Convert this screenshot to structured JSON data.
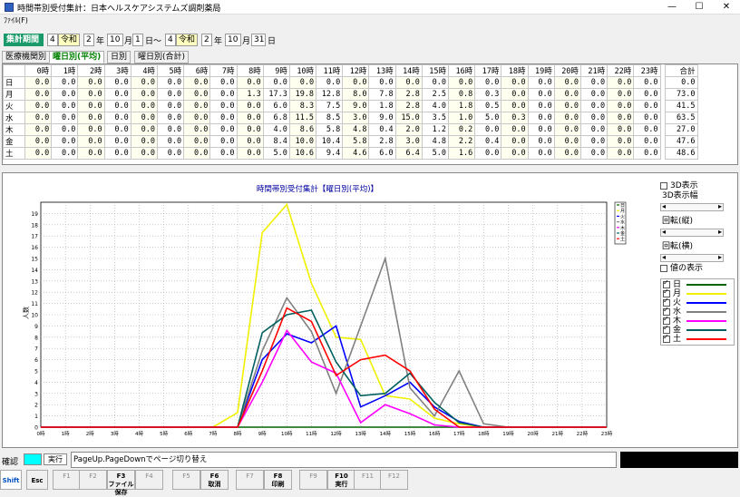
{
  "window": {
    "title": "時間帯別受付集計：日本ヘルスケアシステムズ調剤薬局"
  },
  "menu": {
    "file": "ﾌｧｲﾙ(F)"
  },
  "criteria": {
    "label": "集計期間",
    "from": {
      "num": "4",
      "era": "令和",
      "year": "2",
      "year_unit": "年",
      "month": "10",
      "month_unit": "月",
      "day": "1",
      "day_unit": "日～"
    },
    "to": {
      "num": "4",
      "era": "令和",
      "year": "2",
      "year_unit": "年",
      "month": "10",
      "month_unit": "月",
      "day": "31",
      "day_unit": "日"
    }
  },
  "tabs": [
    "医療機関別",
    "曜日別(平均)",
    "日別",
    "曜日別(合計)"
  ],
  "table": {
    "hours": [
      "0時",
      "1時",
      "2時",
      "3時",
      "4時",
      "5時",
      "6時",
      "7時",
      "8時",
      "9時",
      "10時",
      "11時",
      "12時",
      "13時",
      "14時",
      "15時",
      "16時",
      "17時",
      "18時",
      "19時",
      "20時",
      "21時",
      "22時",
      "23時"
    ],
    "total_header": "合計",
    "rows": [
      {
        "day": "日",
        "values": [
          "0.0",
          "0.0",
          "0.0",
          "0.0",
          "0.0",
          "0.0",
          "0.0",
          "0.0",
          "0.0",
          "0.0",
          "0.0",
          "0.0",
          "0.0",
          "0.0",
          "0.0",
          "0.0",
          "0.0",
          "0.0",
          "0.0",
          "0.0",
          "0.0",
          "0.0",
          "0.0",
          "0.0"
        ],
        "total": "0.0"
      },
      {
        "day": "月",
        "values": [
          "0.0",
          "0.0",
          "0.0",
          "0.0",
          "0.0",
          "0.0",
          "0.0",
          "0.0",
          "1.3",
          "17.3",
          "19.8",
          "12.8",
          "8.0",
          "7.8",
          "2.8",
          "2.5",
          "0.8",
          "0.3",
          "0.0",
          "0.0",
          "0.0",
          "0.0",
          "0.0",
          "0.0"
        ],
        "total": "73.0"
      },
      {
        "day": "火",
        "values": [
          "0.0",
          "0.0",
          "0.0",
          "0.0",
          "0.0",
          "0.0",
          "0.0",
          "0.0",
          "0.0",
          "6.0",
          "8.3",
          "7.5",
          "9.0",
          "1.8",
          "2.8",
          "4.0",
          "1.8",
          "0.5",
          "0.0",
          "0.0",
          "0.0",
          "0.0",
          "0.0",
          "0.0"
        ],
        "total": "41.5"
      },
      {
        "day": "水",
        "values": [
          "0.0",
          "0.0",
          "0.0",
          "0.0",
          "0.0",
          "0.0",
          "0.0",
          "0.0",
          "0.0",
          "6.8",
          "11.5",
          "8.5",
          "3.0",
          "9.0",
          "15.0",
          "3.5",
          "1.0",
          "5.0",
          "0.3",
          "0.0",
          "0.0",
          "0.0",
          "0.0",
          "0.0"
        ],
        "total": "63.5"
      },
      {
        "day": "木",
        "values": [
          "0.0",
          "0.0",
          "0.0",
          "0.0",
          "0.0",
          "0.0",
          "0.0",
          "0.0",
          "0.0",
          "4.0",
          "8.6",
          "5.8",
          "4.8",
          "0.4",
          "2.0",
          "1.2",
          "0.2",
          "0.0",
          "0.0",
          "0.0",
          "0.0",
          "0.0",
          "0.0",
          "0.0"
        ],
        "total": "27.0"
      },
      {
        "day": "金",
        "values": [
          "0.0",
          "0.0",
          "0.0",
          "0.0",
          "0.0",
          "0.0",
          "0.0",
          "0.0",
          "0.0",
          "8.4",
          "10.0",
          "10.4",
          "5.8",
          "2.8",
          "3.0",
          "4.8",
          "2.2",
          "0.4",
          "0.0",
          "0.0",
          "0.0",
          "0.0",
          "0.0",
          "0.0"
        ],
        "total": "47.6"
      },
      {
        "day": "土",
        "values": [
          "0.0",
          "0.0",
          "0.0",
          "0.0",
          "0.0",
          "0.0",
          "0.0",
          "0.0",
          "0.0",
          "5.0",
          "10.6",
          "9.4",
          "4.6",
          "6.0",
          "6.4",
          "5.0",
          "1.6",
          "0.0",
          "0.0",
          "0.0",
          "0.0",
          "0.0",
          "0.0",
          "0.0"
        ],
        "total": "48.6"
      }
    ]
  },
  "chart_data": {
    "type": "line",
    "title": "時間帯別受付集計【曜日別(平均)】",
    "xlabel": "",
    "ylabel": "人数",
    "categories": [
      "0時",
      "1時",
      "2時",
      "3時",
      "4時",
      "5時",
      "6時",
      "7時",
      "8時",
      "9時",
      "10時",
      "11時",
      "12時",
      "13時",
      "14時",
      "15時",
      "16時",
      "17時",
      "18時",
      "19時",
      "20時",
      "21時",
      "22時",
      "23時"
    ],
    "ylim": [
      0,
      20
    ],
    "yticks": [
      "0",
      "1",
      "2",
      "3",
      "4",
      "5",
      "6",
      "7",
      "8",
      "9",
      "10",
      "11",
      "12",
      "13",
      "14",
      "15",
      "16",
      "17",
      "18",
      "19"
    ],
    "grid": true,
    "series": [
      {
        "name": "日",
        "color": "#006400",
        "values": [
          0,
          0,
          0,
          0,
          0,
          0,
          0,
          0,
          0,
          0,
          0,
          0,
          0,
          0,
          0,
          0,
          0,
          0,
          0,
          0,
          0,
          0,
          0,
          0
        ]
      },
      {
        "name": "月",
        "color": "#f0f000",
        "values": [
          0,
          0,
          0,
          0,
          0,
          0,
          0,
          0,
          1.3,
          17.3,
          19.8,
          12.8,
          8.0,
          7.8,
          2.8,
          2.5,
          0.8,
          0.3,
          0,
          0,
          0,
          0,
          0,
          0
        ]
      },
      {
        "name": "火",
        "color": "#0000ff",
        "values": [
          0,
          0,
          0,
          0,
          0,
          0,
          0,
          0,
          0,
          6.0,
          8.3,
          7.5,
          9.0,
          1.8,
          2.8,
          4.0,
          1.8,
          0.5,
          0,
          0,
          0,
          0,
          0,
          0
        ]
      },
      {
        "name": "水",
        "color": "#808080",
        "values": [
          0,
          0,
          0,
          0,
          0,
          0,
          0,
          0,
          0,
          6.8,
          11.5,
          8.5,
          3.0,
          9.0,
          15.0,
          3.5,
          1.0,
          5.0,
          0.3,
          0,
          0,
          0,
          0,
          0
        ]
      },
      {
        "name": "木",
        "color": "#ff00ff",
        "values": [
          0,
          0,
          0,
          0,
          0,
          0,
          0,
          0,
          0,
          4.0,
          8.6,
          5.8,
          4.8,
          0.4,
          2.0,
          1.2,
          0.2,
          0,
          0,
          0,
          0,
          0,
          0,
          0
        ]
      },
      {
        "name": "金",
        "color": "#006060",
        "values": [
          0,
          0,
          0,
          0,
          0,
          0,
          0,
          0,
          0,
          8.4,
          10.0,
          10.4,
          5.8,
          2.8,
          3.0,
          4.8,
          2.2,
          0.4,
          0,
          0,
          0,
          0,
          0,
          0
        ]
      },
      {
        "name": "土",
        "color": "#ff0000",
        "values": [
          0,
          0,
          0,
          0,
          0,
          0,
          0,
          0,
          0,
          5.0,
          10.6,
          9.4,
          4.6,
          6.0,
          6.4,
          5.0,
          1.6,
          0,
          0,
          0,
          0,
          0,
          0,
          0
        ]
      }
    ]
  },
  "side": {
    "opt_3d": "3D表示",
    "width_3d": "3D表示幅",
    "rot_v": "回転(縦)",
    "rot_h": "回転(横)",
    "show_values": "値の表示"
  },
  "status": {
    "confirm": "確認",
    "run": "実行",
    "message": "PageUp.PageDownでページ切り替え"
  },
  "fkeys": [
    {
      "key": "Shift",
      "label": "",
      "on": true
    },
    {
      "key": "Esc",
      "label": "",
      "on": true
    },
    {
      "key": "F1",
      "label": "",
      "on": false
    },
    {
      "key": "F2",
      "label": "",
      "on": false
    },
    {
      "key": "F3",
      "label": "ファイル保存",
      "on": true
    },
    {
      "key": "F4",
      "label": "",
      "on": false
    },
    {
      "key": "F5",
      "label": "",
      "on": false
    },
    {
      "key": "F6",
      "label": "取消",
      "on": true
    },
    {
      "key": "F7",
      "label": "",
      "on": false
    },
    {
      "key": "F8",
      "label": "印刷",
      "on": true
    },
    {
      "key": "F9",
      "label": "",
      "on": false
    },
    {
      "key": "F10",
      "label": "実行",
      "on": true
    },
    {
      "key": "F11",
      "label": "",
      "on": false
    },
    {
      "key": "F12",
      "label": "",
      "on": false
    }
  ]
}
